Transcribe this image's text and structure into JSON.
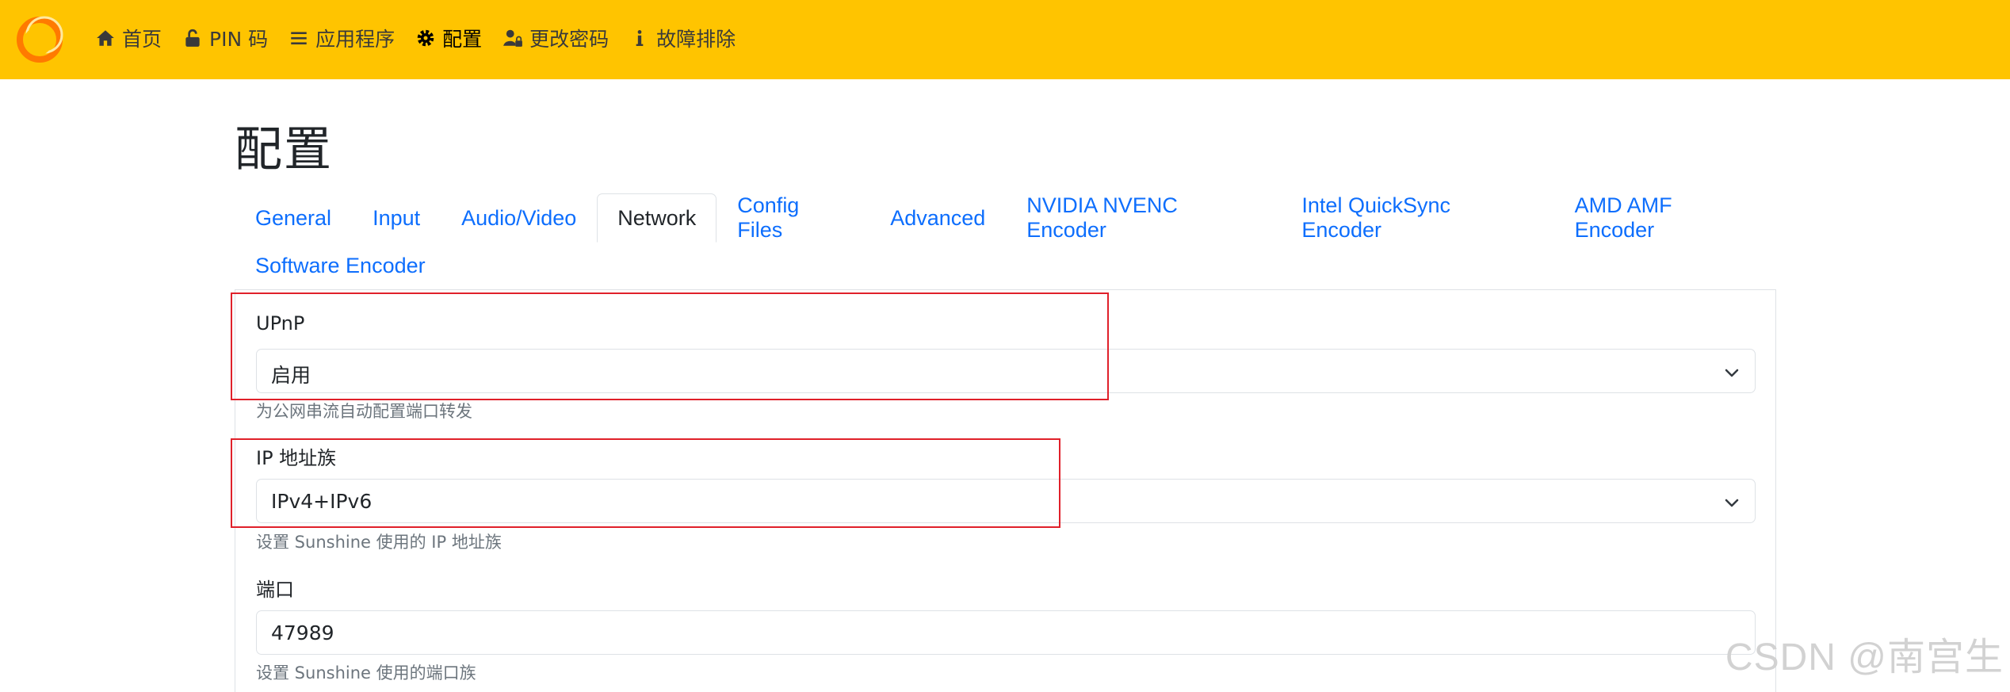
{
  "nav": {
    "home": "首页",
    "pin": "PIN 码",
    "apps": "应用程序",
    "config": "配置",
    "password": "更改密码",
    "troubleshoot": "故障排除"
  },
  "page": {
    "title": "配置"
  },
  "tabs": [
    "General",
    "Input",
    "Audio/Video",
    "Network",
    "Config Files",
    "Advanced",
    "NVIDIA NVENC Encoder",
    "Intel QuickSync Encoder",
    "AMD AMF Encoder",
    "Software Encoder"
  ],
  "active_tab": "Network",
  "fields": {
    "upnp": {
      "label": "UPnP",
      "value": "启用",
      "help": "为公网串流自动配置端口转发"
    },
    "address_family": {
      "label": "IP 地址族",
      "value": "IPv4+IPv6",
      "help": "设置 Sunshine 使用的 IP 地址族"
    },
    "port": {
      "label": "端口",
      "value": "47989",
      "help": "设置 Sunshine 使用的端口族"
    }
  },
  "watermark": "CSDN @南宫生",
  "colors": {
    "navbar": "#ffc400",
    "link": "#0d6efd",
    "annotation": "#e0202a"
  },
  "icons": [
    "sunshine-logo",
    "home-icon",
    "lock-open-icon",
    "list-icon",
    "gear-icon",
    "user-lock-icon",
    "info-icon",
    "chevron-down-icon"
  ]
}
